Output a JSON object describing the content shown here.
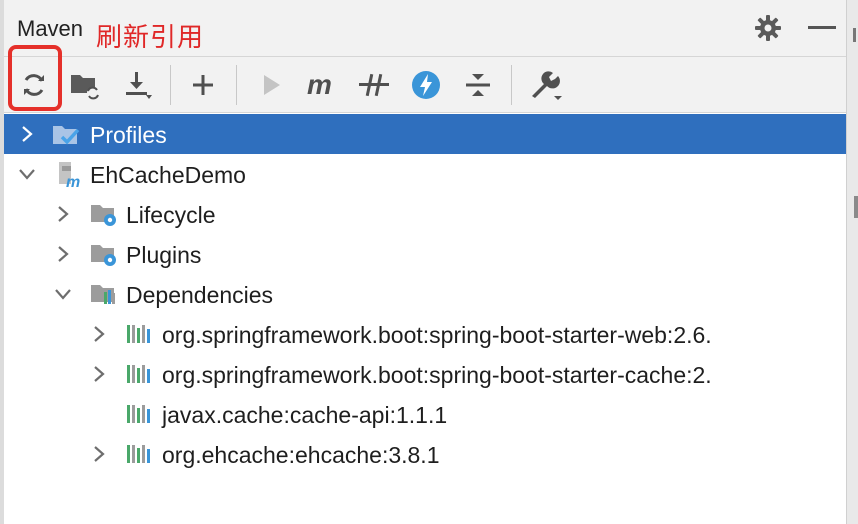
{
  "panel": {
    "title": "Maven",
    "annotation": "刷新引用"
  },
  "toolbar": {
    "buttons": [
      "reload-all-projects",
      "generate-sources",
      "download-sources",
      "add-project",
      "run",
      "execute-goal",
      "toggle-offline",
      "skip-tests",
      "collapse-all",
      "settings"
    ]
  },
  "tree": {
    "items": [
      {
        "label": "Profiles",
        "icon": "profiles-icon",
        "expanded": false,
        "selected": true
      },
      {
        "label": "EhCacheDemo",
        "icon": "maven-module-icon",
        "expanded": true,
        "selected": false
      },
      {
        "label": "Lifecycle",
        "icon": "lifecycle-folder-icon",
        "expanded": false,
        "selected": false
      },
      {
        "label": "Plugins",
        "icon": "plugins-folder-icon",
        "expanded": false,
        "selected": false
      },
      {
        "label": "Dependencies",
        "icon": "dependencies-folder-icon",
        "expanded": true,
        "selected": false
      },
      {
        "label": "org.springframework.boot:spring-boot-starter-web:2.6.",
        "icon": "library-icon",
        "expanded": false,
        "selected": false
      },
      {
        "label": "org.springframework.boot:spring-boot-starter-cache:2.",
        "icon": "library-icon",
        "expanded": false,
        "selected": false
      },
      {
        "label": "javax.cache:cache-api:1.1.1",
        "icon": "library-icon",
        "expanded": false,
        "selected": false
      },
      {
        "label": "org.ehcache:ehcache:3.8.1",
        "icon": "library-icon",
        "expanded": false,
        "selected": false
      }
    ]
  },
  "colors": {
    "selection": "#2f6fbe",
    "annotation": "#e02828",
    "accent_blue": "#3a95d8"
  }
}
